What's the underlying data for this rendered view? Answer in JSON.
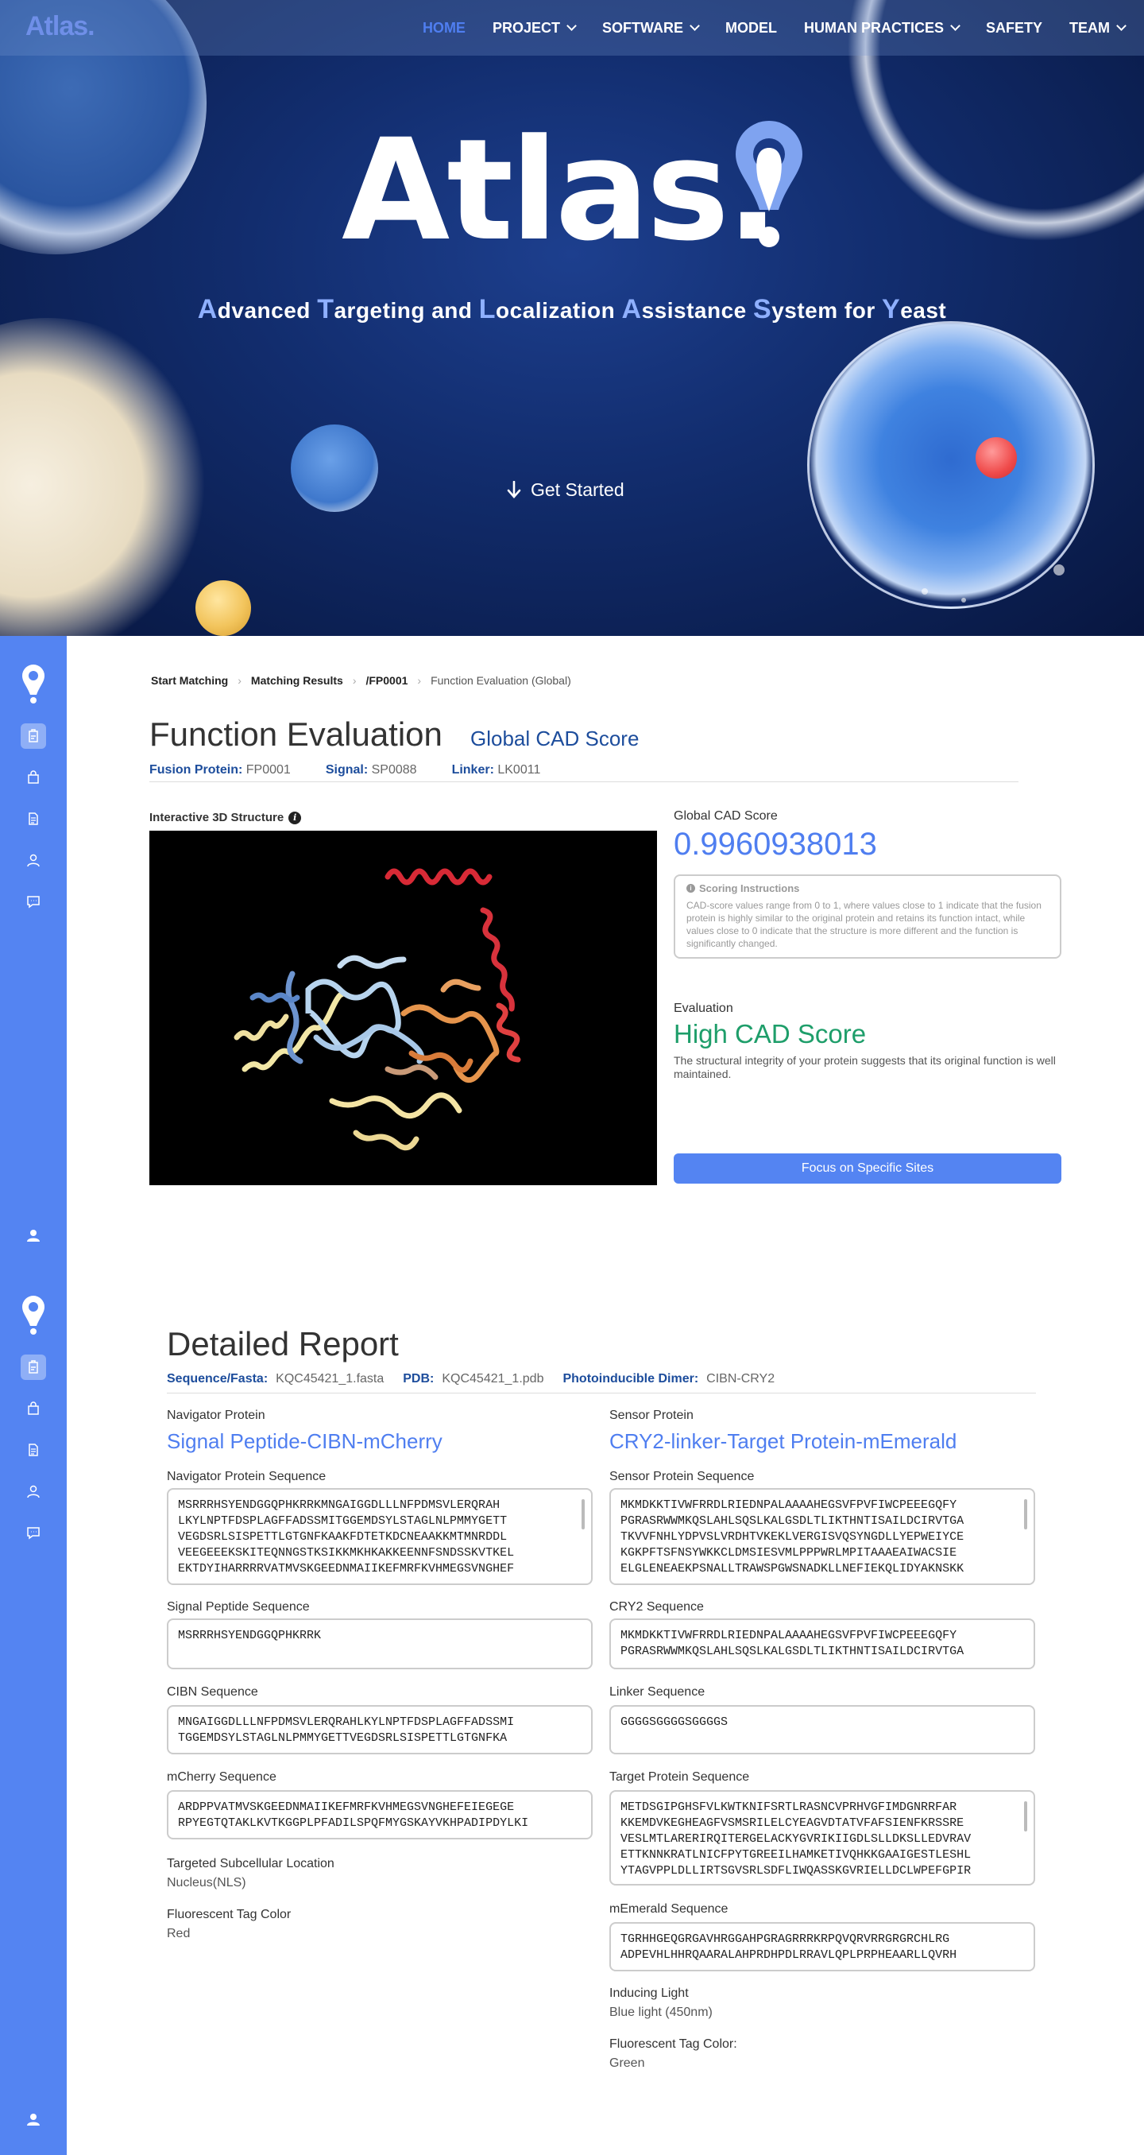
{
  "nav": {
    "logo": "Atlas.",
    "items": [
      {
        "label": "HOME",
        "dropdown": false,
        "active": true
      },
      {
        "label": "PROJECT",
        "dropdown": true,
        "active": false
      },
      {
        "label": "SOFTWARE",
        "dropdown": true,
        "active": false
      },
      {
        "label": "MODEL",
        "dropdown": false,
        "active": false
      },
      {
        "label": "HUMAN PRACTICES",
        "dropdown": true,
        "active": false
      },
      {
        "label": "SAFETY",
        "dropdown": false,
        "active": false
      },
      {
        "label": "TEAM",
        "dropdown": true,
        "active": false
      }
    ]
  },
  "hero": {
    "logo": "Atlas.",
    "tagline_parts": [
      {
        "hl": "A",
        "rest": "dvanced "
      },
      {
        "hl": "T",
        "rest": "argeting and "
      },
      {
        "hl": "L",
        "rest": "ocalization "
      },
      {
        "hl": "A",
        "rest": "ssistance "
      },
      {
        "hl": "S",
        "rest": "ystem for "
      },
      {
        "hl": "Y",
        "rest": "east"
      }
    ],
    "cta": "Get Started"
  },
  "colors": {
    "accent": "#5484f2",
    "link": "#4f7ef0",
    "dark_blue": "#1d4d9c",
    "good": "#1e9e6a"
  },
  "sidebar_icons": [
    "atlas-pin-logo",
    "protein-icon",
    "bag-icon",
    "document-icon",
    "user-icon",
    "chat-icon",
    "profile-icon"
  ],
  "breadcrumb": [
    "Start Matching",
    "Matching Results",
    "/FP0001",
    "Function Evaluation (Global)"
  ],
  "function_eval": {
    "title": "Function Evaluation",
    "subtitle": "Global CAD Score",
    "fusion_protein_label": "Fusion Protein:",
    "fusion_protein": "FP0001",
    "signal_label": "Signal:",
    "signal": "SP0088",
    "linker_label": "Linker:",
    "linker": "LK0011",
    "structure_label": "Interactive 3D Structure",
    "score_label": "Global CAD Score",
    "score": "0.9960938013",
    "instructions_title": "Scoring Instructions",
    "instructions_body": "CAD-score values range from 0 to 1, where values close to 1 indicate that the fusion protein is highly similar to the original protein and retains its function intact, while values close to 0 indicate that the structure is more different and the function is significantly changed.",
    "evaluation_label": "Evaluation",
    "evaluation_result": "High CAD Score",
    "evaluation_desc": "The structural integrity of your protein suggests that its original function is well maintained.",
    "focus_button": "Focus on Specific Sites"
  },
  "report": {
    "title": "Detailed Report",
    "seq_label": "Sequence/Fasta:",
    "seq_value": "KQC45421_1.fasta",
    "pdb_label": "PDB:",
    "pdb_value": "KQC45421_1.pdb",
    "dimer_label": "Photoinducible Dimer:",
    "dimer_value": "CIBN-CRY2",
    "left": {
      "heading": "Navigator Protein",
      "name": "Signal Peptide-CIBN-mCherry",
      "navigator_seq_label": "Navigator Protein Sequence",
      "navigator_seq_lines": [
        "MSRRRHSYENDGGQPHKRRKMNGAIGGDLLLNFPDMSVLERQRAH",
        "LKYLNPTFDSPLAGFFADSSMITGGEMDSYLSTAGLNLPMMYGETT",
        "VEGDSRLSISPETTLGTGNFKAAKFDTETKDCNEAAKKMTMNRDDL",
        "VEEGEEEKSKITEQNNGSTKSIKKMKHKAKKEENNFSNDSSKVTKEL",
        "EKTDYIHARRRRVATMVSKGEEDNMAIIKEFMRFKVHMEGSVNGHEF"
      ],
      "signal_seq_label": "Signal Peptide Sequence",
      "signal_seq": "MSRRRHSYENDGGQPHKRRK",
      "cibn_seq_label": "CIBN Sequence",
      "cibn_seq_lines": [
        "MNGAIGGDLLLNFPDMSVLERQRAHLKYLNPTFDSPLAGFFADSSMI",
        "TGGEMDSYLSTAGLNLPMMYGETTVEGDSRLSISPETTLGTGNFKA"
      ],
      "mcherry_seq_label": "mCherry Sequence",
      "mcherry_seq_lines": [
        "ARDPPVATMVSKGEEDNMAIIKEFMRFKVHMEGSVNGHEFEIEGEGE",
        "RPYEGTQTAKLKVTKGGPLPFADILSPQFMYGSKAYVKHPADIPDYLKI"
      ],
      "location_label": "Targeted Subcellular Location",
      "location_value": "Nucleus(NLS)",
      "tag_label": "Fluorescent Tag Color",
      "tag_value": "Red"
    },
    "right": {
      "heading": "Sensor Protein",
      "name": "CRY2-linker-Target Protein-mEmerald",
      "sensor_seq_label": "Sensor Protein Sequence",
      "sensor_seq_lines": [
        "MKMDKKTIVWFRRDLRIEDNPALAAAAHEGSVFPVFIWCPEEEGQFY",
        "PGRASRWWMKQSLAHLSQSLKALGSDLTLIKTHNTISAILDCIRVTGA",
        "TKVVFNHLYDPVSLVRDHTVKEKLVERGISVQSYNGDLLYEPWEIYCE",
        "KGKPFTSFNSYWKKCLDMSIESVMLPPPWRLMPITAAAEAIWACSIE",
        "ELGLENEAEKPSNALLTRAWSPGWSNADKLLNEFIEKQLIDYAKNSKK"
      ],
      "cry2_seq_label": "CRY2 Sequence",
      "cry2_seq_lines": [
        "MKMDKKTIVWFRRDLRIEDNPALAAAAHEGSVFPVFIWCPEEEGQFY",
        "PGRASRWWMKQSLAHLSQSLKALGSDLTLIKTHNTISAILDCIRVTGA"
      ],
      "linker_seq_label": "Linker Sequence",
      "linker_seq": "GGGGSGGGGSGGGGS",
      "target_seq_label": "Target Protein Sequence",
      "target_seq_lines": [
        "METDSGIPGHSFVLKWTKNIFSRTLRASNCVPRHVGFIMDGNRRFAR",
        "KKEMDVKEGHEAGFVSMSRILELCYEAGVDTATVFAFSIENFKRSSRE",
        "VESLMTLARERIRQITERGELACKYGVRIKIIGDLSLLDKSLLEDVRAV",
        "ETTKNNKRATLNICFPYTGREEILHAMKETIVQHKKGAAIGESTLESHL",
        "YTAGVPPLDLLIRTSGVSRLSDFLIWQASSKGVRIELLDCLWPEFGPIR"
      ],
      "memerald_seq_label": "mEmerald Sequence",
      "memerald_seq_lines": [
        "TGRHHGEQGRGAVHRGGAHPGRAGRRRKRPQVQRVRRGRGRCHLRG",
        "ADPEVHLHHRQAARALAHPRDHPDLRRAVLQPLPRPHEAARLLQVRH"
      ],
      "light_label": "Inducing Light",
      "light_value": "Blue light (450nm)",
      "tag_label": "Fluorescent Tag Color:",
      "tag_value": "Green"
    }
  }
}
